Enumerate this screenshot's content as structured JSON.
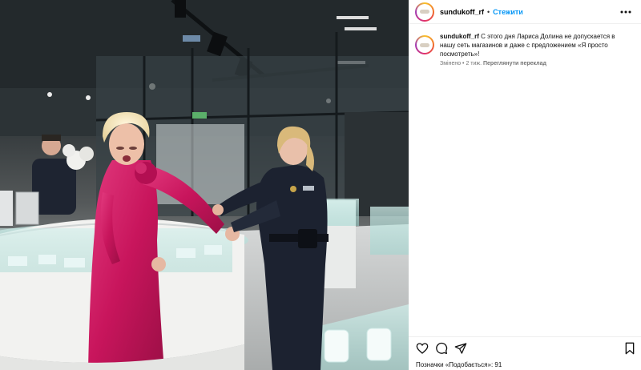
{
  "post": {
    "username": "sundukoff_rf",
    "separator": "•",
    "follow_label": "Стежити",
    "more_icon": "more-horizontal-icon",
    "caption": {
      "username": "sundukoff_rf",
      "text": "С этого дня Лариса Долина не допускается в нашу сеть магазинов и даже с предложением «Я просто посмотреть»!",
      "edited_label": "Змінено • 2 тиж.",
      "translate_label": "Переглянути переклад"
    },
    "actions": {
      "like_icon": "heart-icon",
      "comment_icon": "comment-icon",
      "share_icon": "send-icon",
      "save_icon": "bookmark-icon"
    },
    "likes_text": "Позначки «Подобається»: 91"
  },
  "colors": {
    "accent": "#0095f6",
    "dress": "#c8155c",
    "uniform": "#1c2230"
  }
}
